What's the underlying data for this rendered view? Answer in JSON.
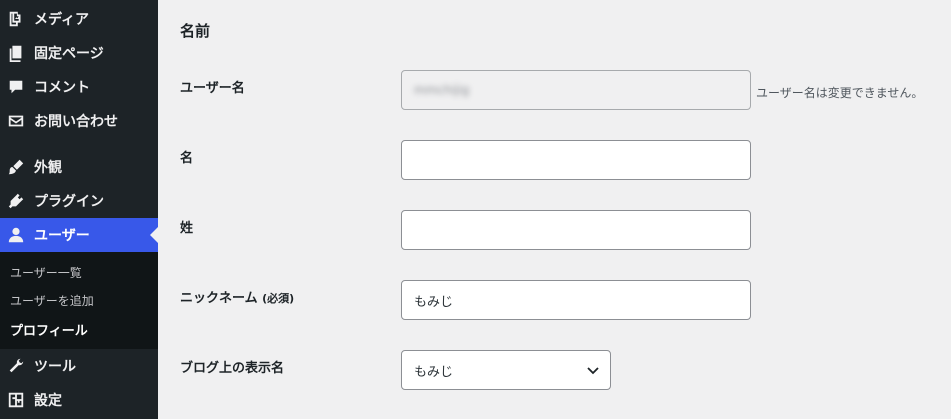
{
  "sidebar": {
    "items": [
      {
        "label": "メディア",
        "icon": "media-icon"
      },
      {
        "label": "固定ページ",
        "icon": "pages-icon"
      },
      {
        "label": "コメント",
        "icon": "comment-icon"
      },
      {
        "label": "お問い合わせ",
        "icon": "mail-icon"
      },
      {
        "label": "外観",
        "icon": "appearance-brush-icon"
      },
      {
        "label": "プラグイン",
        "icon": "plugin-icon"
      },
      {
        "label": "ユーザー",
        "icon": "user-icon"
      },
      {
        "label": "ツール",
        "icon": "wrench-icon"
      },
      {
        "label": "設定",
        "icon": "settings-icon"
      }
    ],
    "submenu": [
      {
        "label": "ユーザー一覧"
      },
      {
        "label": "ユーザーを追加"
      },
      {
        "label": "プロフィール"
      }
    ],
    "current_color": "#3858e9"
  },
  "main": {
    "section_title": "名前",
    "username": {
      "label": "ユーザー名",
      "value": "mmchijig",
      "description": "ユーザー名は変更できません。"
    },
    "first_name": {
      "label": "名",
      "value": ""
    },
    "last_name": {
      "label": "姓",
      "value": ""
    },
    "nickname": {
      "label": "ニックネーム",
      "required": "(必須)",
      "value": "もみじ"
    },
    "display_name": {
      "label": "ブログ上の表示名",
      "selected": "もみじ"
    }
  }
}
